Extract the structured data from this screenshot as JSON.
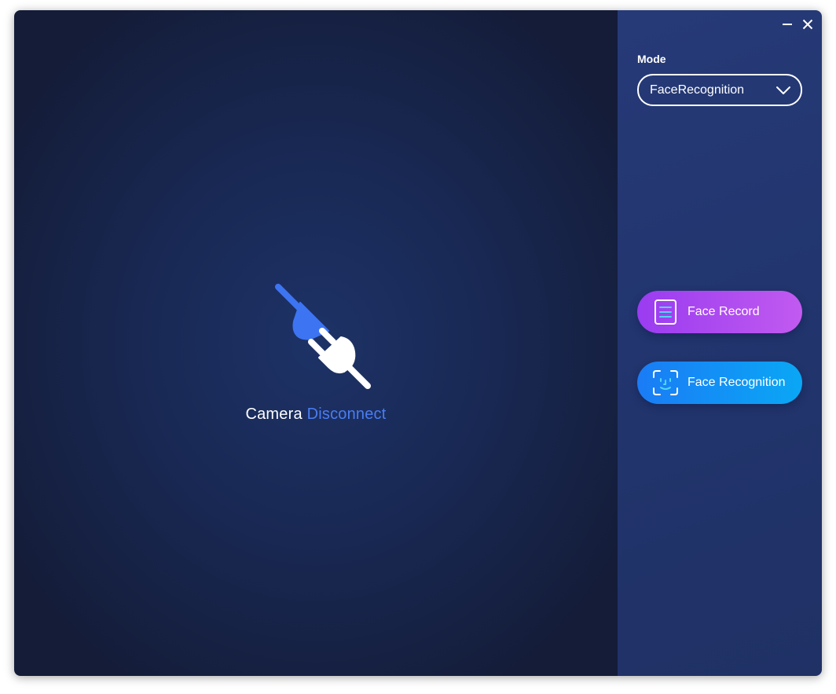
{
  "window": {
    "minimize_icon": "minimize-icon",
    "close_icon": "close-icon"
  },
  "camera_view": {
    "status_camera": "Camera",
    "status_disconnect": "Disconnect",
    "graphic_icon": "plug-disconnect-icon",
    "accent_color": "#4a7df3"
  },
  "side_panel": {
    "mode_label": "Mode",
    "mode_selected": "FaceRecognition",
    "buttons": [
      {
        "label": "Face Record",
        "icon": "face-record-icon",
        "color": "#a846f0"
      },
      {
        "label": "Face Recognition",
        "icon": "face-scan-icon",
        "color": "#1290f5"
      }
    ]
  }
}
